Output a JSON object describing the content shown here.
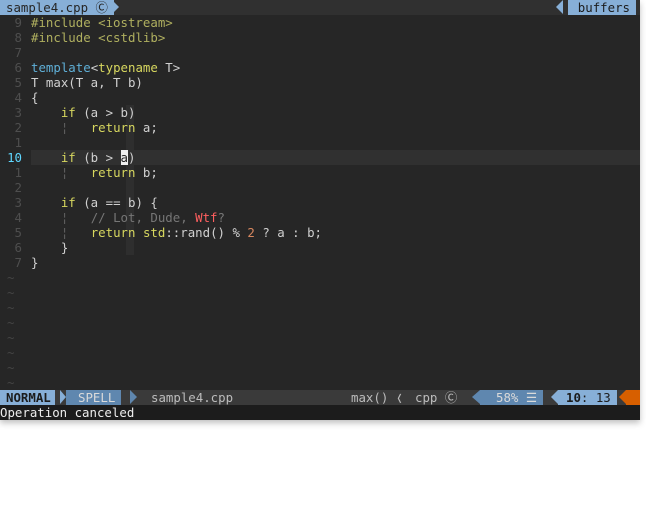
{
  "tabline": {
    "file": "sample4.cpp",
    "icon": "c-icon",
    "buffers_label": "buffers"
  },
  "code": [
    {
      "n": "9",
      "tokens": [
        [
          "str",
          "#include <iostream>"
        ]
      ]
    },
    {
      "n": "8",
      "tokens": [
        [
          "str",
          "#include <cstdlib>"
        ]
      ]
    },
    {
      "n": "7",
      "tokens": []
    },
    {
      "n": "6",
      "tokens": [
        [
          "kw2",
          "template"
        ],
        [
          "plain",
          "<"
        ],
        [
          "kw",
          "typename"
        ],
        [
          "plain",
          " T>"
        ]
      ]
    },
    {
      "n": "5",
      "tokens": [
        [
          "plain",
          "T max(T a, T b)"
        ]
      ]
    },
    {
      "n": "4",
      "tokens": [
        [
          "plain",
          "{"
        ]
      ]
    },
    {
      "n": "3",
      "tokens": [
        [
          "plain",
          "    "
        ],
        [
          "kw",
          "if"
        ],
        [
          "plain",
          " (a > b)"
        ]
      ]
    },
    {
      "n": "2",
      "tokens": [
        [
          "plain",
          "    "
        ],
        [
          "guide",
          "¦"
        ],
        [
          "plain",
          "   "
        ],
        [
          "kw",
          "return"
        ],
        [
          "plain",
          " a;"
        ]
      ]
    },
    {
      "n": "1",
      "tokens": []
    },
    {
      "n": "10",
      "current": true,
      "tokens": [
        [
          "plain",
          "    "
        ],
        [
          "kw",
          "if"
        ],
        [
          "plain",
          " (b > "
        ],
        [
          "cursor",
          "a"
        ],
        [
          "plain",
          ")"
        ]
      ]
    },
    {
      "n": "1",
      "tokens": [
        [
          "plain",
          "    "
        ],
        [
          "guide",
          "¦"
        ],
        [
          "plain",
          "   "
        ],
        [
          "kw",
          "return"
        ],
        [
          "plain",
          " b;"
        ]
      ]
    },
    {
      "n": "2",
      "tokens": []
    },
    {
      "n": "3",
      "tokens": [
        [
          "plain",
          "    "
        ],
        [
          "kw",
          "if"
        ],
        [
          "plain",
          " (a == b) {"
        ]
      ]
    },
    {
      "n": "4",
      "tokens": [
        [
          "plain",
          "    "
        ],
        [
          "guide",
          "¦"
        ],
        [
          "plain",
          "   "
        ],
        [
          "cmt",
          "// Lot, Dude, "
        ],
        [
          "todo",
          "Wtf"
        ],
        [
          "cmt",
          "?"
        ]
      ]
    },
    {
      "n": "5",
      "tokens": [
        [
          "plain",
          "    "
        ],
        [
          "guide",
          "¦"
        ],
        [
          "plain",
          "   "
        ],
        [
          "kw",
          "return"
        ],
        [
          "plain",
          " "
        ],
        [
          "kw",
          "std"
        ],
        [
          "plain",
          "::rand() % "
        ],
        [
          "num",
          "2"
        ],
        [
          "plain",
          " ? a : b;"
        ]
      ]
    },
    {
      "n": "6",
      "tokens": [
        [
          "plain",
          "    }"
        ]
      ]
    },
    {
      "n": "7",
      "tokens": [
        [
          "plain",
          "}"
        ]
      ]
    }
  ],
  "tilde_count": 8,
  "tilde": "~",
  "statusline": {
    "mode": "NORMAL",
    "spell": "SPELL",
    "filename": "sample4.cpp",
    "function": "max() ❬",
    "filetype": "cpp",
    "percent": "58% ☰",
    "line": "10",
    "col": ": 13"
  },
  "cmdline": "Operation canceled",
  "colors": {
    "background": "#262626",
    "accent": "#87afd7",
    "accent_dark": "#5f87af",
    "warning": "#d75f00"
  }
}
